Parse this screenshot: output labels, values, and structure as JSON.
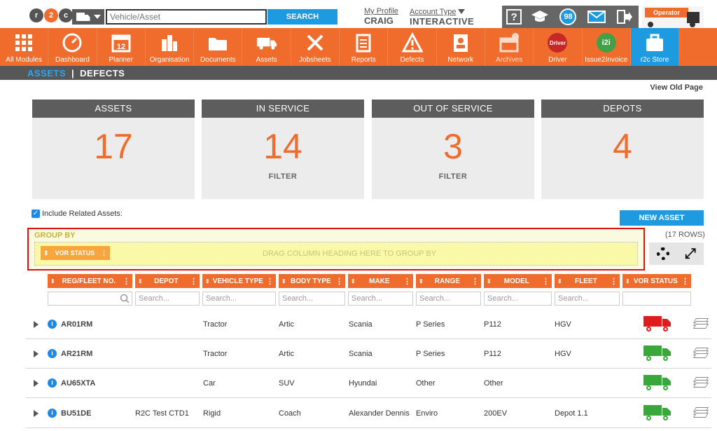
{
  "header": {
    "logo": "r2c",
    "search_placeholder": "Vehicle/Asset",
    "search_button": "SEARCH",
    "profile_link": "My Profile",
    "profile_name": "CRAIG",
    "account_link": "Account Type",
    "account_value": "INTERACTIVE",
    "notification_count": "98",
    "operator_label": "Operator"
  },
  "nav": [
    {
      "label": "All Modules",
      "icon": "grid-icon"
    },
    {
      "label": "Dashboard",
      "icon": "speedometer-icon"
    },
    {
      "label": "Planner",
      "icon": "calendar-icon"
    },
    {
      "label": "Organisation",
      "icon": "building-icon"
    },
    {
      "label": "Documents",
      "icon": "folder-icon"
    },
    {
      "label": "Assets",
      "icon": "truck-icon"
    },
    {
      "label": "Jobsheets",
      "icon": "tools-icon"
    },
    {
      "label": "Reports",
      "icon": "clipboard-icon"
    },
    {
      "label": "Defects",
      "icon": "warning-icon"
    },
    {
      "label": "Network",
      "icon": "contacts-icon"
    },
    {
      "label": "Archives",
      "icon": "archive-icon"
    },
    {
      "label": "Driver",
      "icon": "driver-logo-icon"
    },
    {
      "label": "Issue2Invoice",
      "icon": "i2i-logo-icon"
    },
    {
      "label": "r2c Store",
      "icon": "store-bag-icon"
    }
  ],
  "calendar_day": "12",
  "driver_logo_text": "Driver",
  "i2i_logo_text": "i2i",
  "subnav": {
    "assets": "ASSETS",
    "separator": "|",
    "defects": "DEFECTS"
  },
  "view_old_page": "View Old Page",
  "stats": [
    {
      "title": "ASSETS",
      "value": "17",
      "filter": ""
    },
    {
      "title": "IN SERVICE",
      "value": "14",
      "filter": "FILTER"
    },
    {
      "title": "OUT OF SERVICE",
      "value": "3",
      "filter": "FILTER"
    },
    {
      "title": "DEPOTS",
      "value": "4",
      "filter": ""
    }
  ],
  "include_related": "Include Related Assets:",
  "new_asset": "NEW ASSET",
  "row_count": "(17 ROWS)",
  "group_by": {
    "title": "GROUP BY",
    "chip": "VOR STATUS",
    "hint": "DRAG COLUMN HEADING HERE TO GROUP BY"
  },
  "columns": [
    "REG/FLEET NO.",
    "DEPOT",
    "VEHICLE TYPE",
    "BODY TYPE",
    "MAKE",
    "RANGE",
    "MODEL",
    "FLEET",
    "VOR STATUS"
  ],
  "search_filter_placeholder": "Search...",
  "rows": [
    {
      "reg": "AR01RM",
      "depot": "",
      "vehicle_type": "Tractor",
      "body_type": "Artic",
      "make": "Scania",
      "range": "P Series",
      "model": "P112",
      "fleet": "HGV",
      "vor": "red"
    },
    {
      "reg": "AR21RM",
      "depot": "",
      "vehicle_type": "Tractor",
      "body_type": "Artic",
      "make": "Scania",
      "range": "P Series",
      "model": "P112",
      "fleet": "HGV",
      "vor": "green"
    },
    {
      "reg": "AU65XTA",
      "depot": "",
      "vehicle_type": "Car",
      "body_type": "SUV",
      "make": "Hyundai",
      "range": "Other",
      "model": "Other",
      "fleet": "",
      "vor": "green"
    },
    {
      "reg": "BU51DE",
      "depot": "R2C Test CTD1",
      "vehicle_type": "Rigid",
      "body_type": "Coach",
      "make": "Alexander Dennis",
      "range": "Enviro",
      "model": "200EV",
      "fleet": "Depot 1.1",
      "vor": "green"
    }
  ],
  "colors": {
    "orange": "#ef6c2c",
    "blue": "#1e9be0",
    "vor_red": "#e01b1b",
    "vor_green": "#39a83a"
  }
}
